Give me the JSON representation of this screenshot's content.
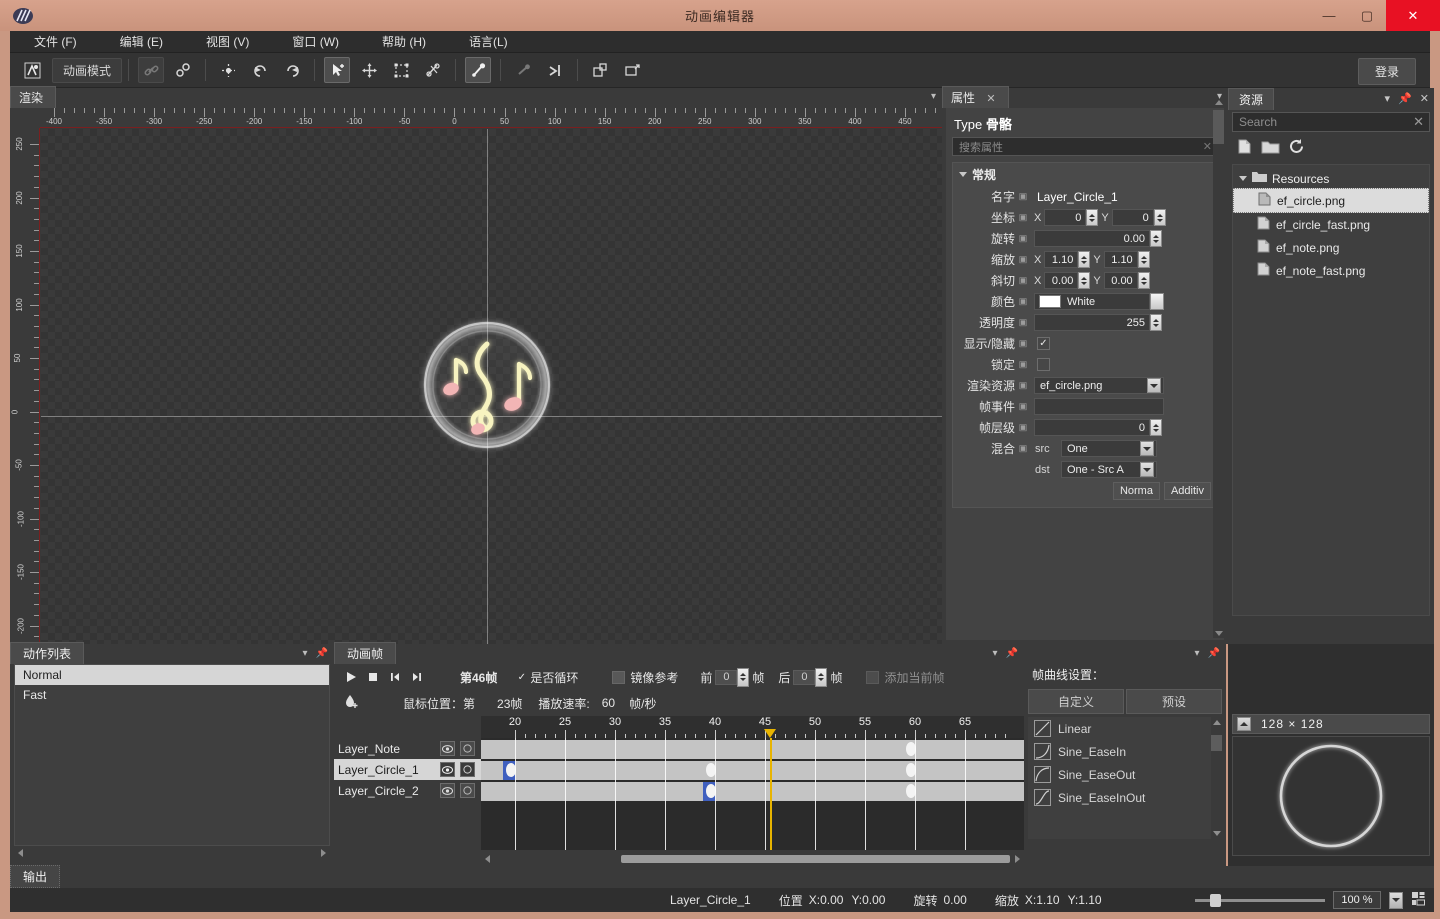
{
  "window": {
    "title": "动画编辑器",
    "minimize": "—",
    "maximize": "▢",
    "close": "✕",
    "logo_icon": "app-logo-icon"
  },
  "menubar": {
    "items": [
      {
        "label": "文件 (F)"
      },
      {
        "label": "编辑 (E)"
      },
      {
        "label": "视图 (V)"
      },
      {
        "label": "窗口 (W)"
      },
      {
        "label": "帮助 (H)"
      },
      {
        "label": "语言(L)"
      }
    ]
  },
  "toolbar": {
    "mode_label": "动画模式",
    "login_label": "登录",
    "buttons": [
      {
        "name": "animation-mode-icon"
      },
      {
        "name": "link-icon"
      },
      {
        "name": "unlink-icon"
      },
      {
        "name": "snap-icon"
      },
      {
        "name": "undo-rotate-icon"
      },
      {
        "name": "redo-rotate-icon"
      },
      {
        "name": "select-move-icon"
      },
      {
        "name": "rotate-tool-icon"
      },
      {
        "name": "scale-tool-icon"
      },
      {
        "name": "skew-tool-icon"
      },
      {
        "name": "bone-tool-icon"
      },
      {
        "name": "bone-bind-icon"
      },
      {
        "name": "bone-ik-icon"
      },
      {
        "name": "new-layer-icon"
      },
      {
        "name": "import-image-icon"
      }
    ]
  },
  "render_panel": {
    "tab_label": "渲染",
    "ruler_h": [
      "-400",
      "-350",
      "-300",
      "-250",
      "-200",
      "-150",
      "-100",
      "-50",
      "0",
      "50",
      "100",
      "150",
      "200",
      "250",
      "300",
      "350",
      "400",
      "450"
    ],
    "ruler_v": [
      "250",
      "200",
      "150",
      "100",
      "50",
      "0",
      "-50",
      "-100",
      "-150",
      "-200"
    ]
  },
  "properties": {
    "tab_label": "属性",
    "tab_close": "✕",
    "type_label": "Type",
    "type_value": "骨骼",
    "search_placeholder": "搜索属性",
    "group_label": "常规",
    "fields": {
      "name_label": "名字",
      "name_value": "Layer_Circle_1",
      "coord_label": "坐标",
      "coord_x": "0",
      "coord_y": "0",
      "rotate_label": "旋转",
      "rotate_value": "0.00",
      "scale_label": "缩放",
      "scale_x": "1.10",
      "scale_y": "1.10",
      "skew_label": "斜切",
      "skew_x": "0.00",
      "skew_y": "0.00",
      "color_label": "颜色",
      "color_value": "White",
      "color_hex": "#ffffff",
      "alpha_label": "透明度",
      "alpha_value": "255",
      "visible_label": "显示/隐藏",
      "visible_checked": "✓",
      "lock_label": "锁定",
      "lock_checked": "",
      "render_res_label": "渲染资源",
      "render_res_value": "ef_circle.png",
      "frame_event_label": "帧事件",
      "frame_event_value": "",
      "frame_layer_label": "帧层级",
      "frame_layer_value": "0",
      "blend_label": "混合",
      "blend_src_label": "src",
      "blend_src_value": "One",
      "blend_dst_label": "dst",
      "blend_dst_value": "One - Src A",
      "blend_normal": "Norma",
      "blend_additive": "Additiv",
      "axis_x": "X",
      "axis_y": "Y"
    }
  },
  "resources": {
    "tab_label": "资源",
    "search_placeholder": "Search",
    "root_label": "Resources",
    "items": [
      {
        "label": "ef_circle.png",
        "selected": true
      },
      {
        "label": "ef_circle_fast.png",
        "selected": false
      },
      {
        "label": "ef_note.png",
        "selected": false
      },
      {
        "label": "ef_note_fast.png",
        "selected": false
      }
    ]
  },
  "action_list": {
    "tab_label": "动作列表",
    "items": [
      {
        "label": "Normal",
        "selected": true
      },
      {
        "label": "Fast",
        "selected": false
      }
    ]
  },
  "animation": {
    "tab_label": "动画帧",
    "current_frame_label": "第46帧",
    "loop_label": "是否循环",
    "loop_checked": "✓",
    "mirror_label": "镜像参考",
    "before_label": "前",
    "before_value": "0",
    "before_unit": "帧",
    "after_label": "后",
    "after_value": "0",
    "after_unit": "帧",
    "add_current_label": "添加当前帧",
    "mouse_pos_label": "鼠标位置：第",
    "mouse_pos_value": "23帧",
    "speed_label": "播放速率:",
    "speed_value": "60",
    "speed_unit": "帧/秒",
    "ruler_numbers": [
      "20",
      "25",
      "30",
      "35",
      "40",
      "45",
      "50",
      "55",
      "60",
      "65"
    ],
    "playhead_frame": "45",
    "layers": [
      {
        "label": "Layer_Note",
        "selected": false
      },
      {
        "label": "Layer_Circle_1",
        "selected": true
      },
      {
        "label": "Layer_Circle_2",
        "selected": false
      }
    ]
  },
  "curve": {
    "title": "帧曲线设置：",
    "tabs": [
      {
        "label": "自定义",
        "active": true
      },
      {
        "label": "预设",
        "active": false
      }
    ],
    "presets": [
      {
        "label": "Linear"
      },
      {
        "label": "Sine_EaseIn"
      },
      {
        "label": "Sine_EaseOut"
      },
      {
        "label": "Sine_EaseInOut"
      }
    ]
  },
  "preview": {
    "size_label": "128  ×  128"
  },
  "output": {
    "tab_label": "输出"
  },
  "status": {
    "layer_name": "Layer_Circle_1",
    "position_label": "位置",
    "position_x": "X:0.00",
    "position_y": "Y:0.00",
    "rotate_label": "旋转",
    "rotate_value": "0.00",
    "scale_label": "缩放",
    "scale_x": "X:1.10",
    "scale_y": "Y:1.10",
    "zoom_value": "100 %"
  },
  "colors": {
    "titlebar": "#c9937c",
    "panel": "#3a3a3a",
    "accent_close": "#e81123",
    "playhead": "#e8b400",
    "selection": "#d6d6d6"
  }
}
